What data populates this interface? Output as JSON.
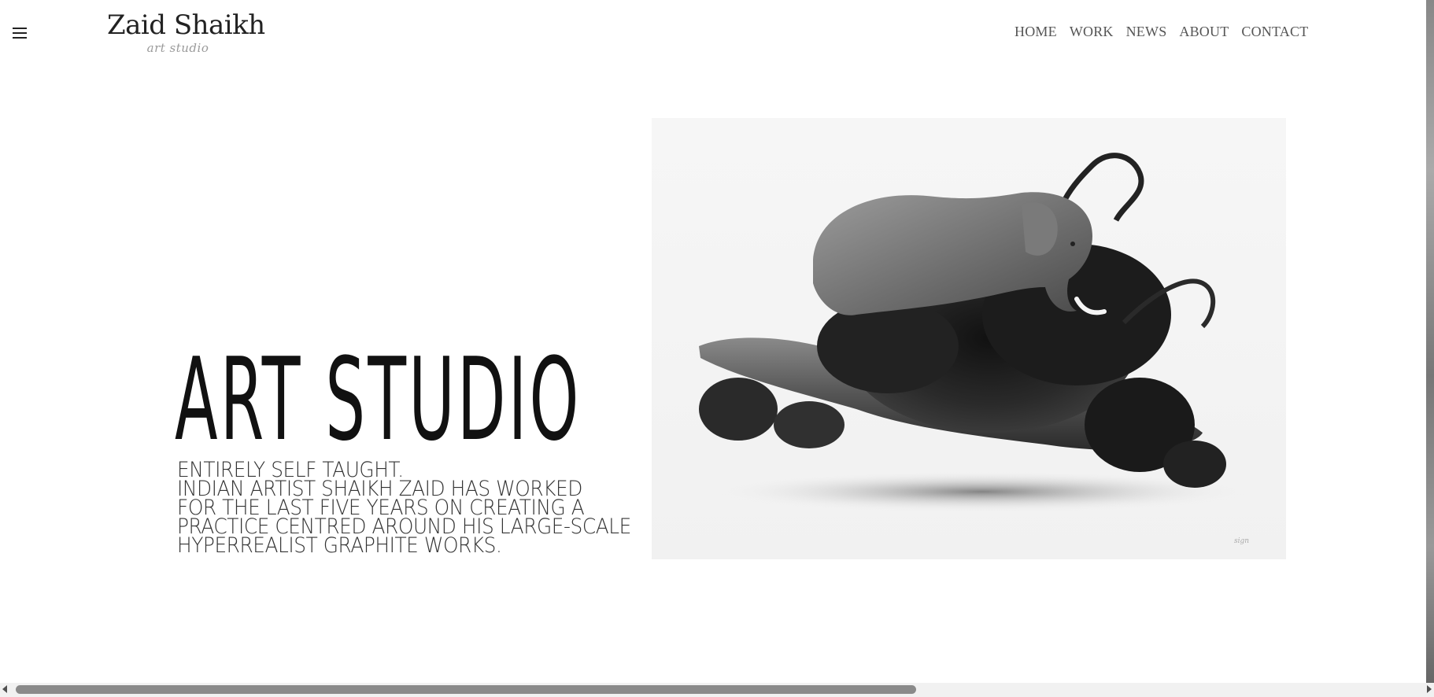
{
  "header": {
    "logo_name": "Zaid Shaikh",
    "logo_subtitle": "art studio",
    "menu_icon": "hamburger-icon",
    "nav": [
      {
        "label": "HOME"
      },
      {
        "label": "WORK"
      },
      {
        "label": "NEWS"
      },
      {
        "label": "ABOUT"
      },
      {
        "label": "CONTACT"
      }
    ]
  },
  "hero": {
    "title": "ART STUDIO",
    "description_lines": [
      "ENTIRELY SELF TAUGHT.",
      "INDIAN ARTIST SHAIKH ZAID HAS WORKED",
      "FOR THE LAST FIVE YEARS ON CREATING A",
      "PRACTICE CENTRED AROUND HIS LARGE-SCALE",
      "HYPERREALIST GRAPHITE WORKS."
    ]
  },
  "artwork": {
    "subject": "graphite drawing of an elephant on a hand within ink-like smoke"
  },
  "colors": {
    "background": "#ffffff",
    "text": "#111111",
    "nav_text": "#555555",
    "scrollbar_thumb": "#8a8a8a"
  }
}
